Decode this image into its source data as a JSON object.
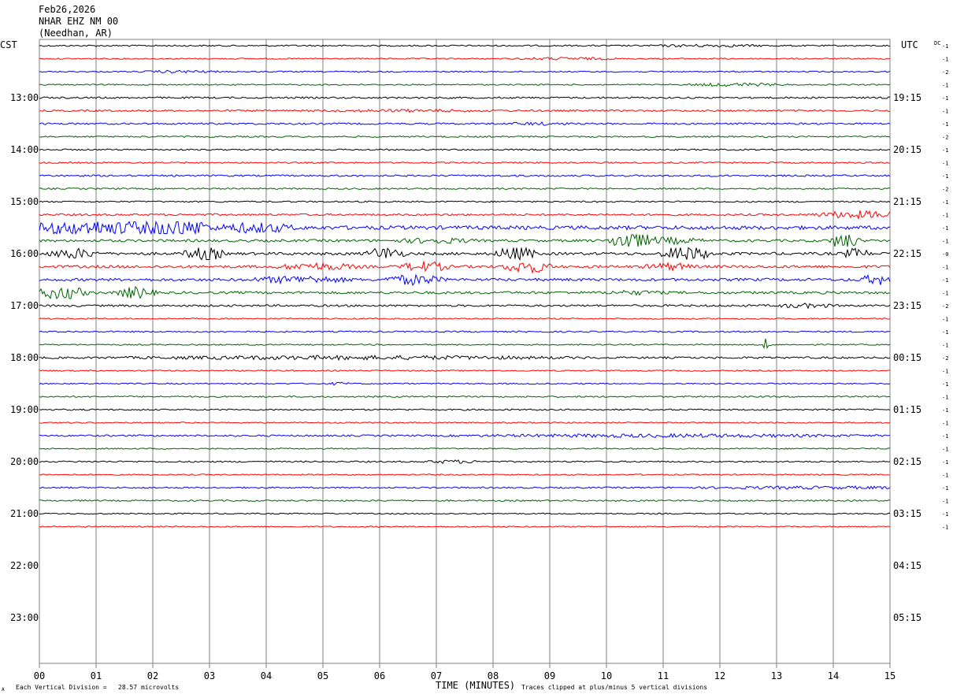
{
  "header": {
    "date": "Feb26,2026",
    "station": "NHAR EHZ NM 00",
    "location": "(Needhan, AR)"
  },
  "left_tz": "CST",
  "right_tz": "UTC",
  "dc_label": "DC",
  "footer": {
    "scale_note": "Each Vertical Division =   28.57 microvolts",
    "xlabel": "TIME (MINUTES)",
    "clip_note": "Traces clipped at plus/minus 5 vertical divisions",
    "mark": "A"
  },
  "colors": {
    "trace_cycle": [
      "#000000",
      "#ff0000",
      "#0000ff",
      "#006400"
    ],
    "grid": "#808080"
  },
  "chart_data": {
    "type": "line",
    "title": "",
    "xlabel": "TIME (MINUTES)",
    "ylabel": "",
    "xlim": [
      0,
      15
    ],
    "x_ticks": [
      "00",
      "01",
      "02",
      "03",
      "04",
      "05",
      "06",
      "07",
      "08",
      "09",
      "10",
      "11",
      "12",
      "13",
      "14",
      "15"
    ],
    "traces_per_hour": 4,
    "rows_total": 44,
    "left_hour_labels": [
      "13:00",
      "14:00",
      "15:00",
      "16:00",
      "17:00",
      "18:00",
      "19:00",
      "20:00",
      "21:00",
      "22:00",
      "23:00"
    ],
    "right_hour_labels": [
      "19:15",
      "20:15",
      "21:15",
      "22:15",
      "23:15",
      "00:15",
      "01:15",
      "02:15",
      "03:15",
      "04:15",
      "05:15"
    ],
    "dc_offsets": [
      "-1",
      "-1",
      "-2",
      "-1",
      "-1",
      "-1",
      "-1",
      "-2",
      "-1",
      "-1",
      "-1",
      "-2",
      "-1",
      "-1",
      "-1",
      "-1",
      "-0",
      "-1",
      "-1",
      "-1",
      "-2",
      "-1",
      "-1",
      "-1",
      "-2",
      "-1",
      "-1",
      "-1",
      "-1",
      "-1",
      "-1",
      "-1",
      "-1",
      "-1",
      "-1",
      "-1",
      "-1",
      "-1"
    ],
    "traces": [
      {
        "color": "#000000",
        "amp": 0.6,
        "events": [
          [
            11.8,
            1.2,
            2
          ]
        ]
      },
      {
        "color": "#ff0000",
        "amp": 0.5,
        "events": [
          [
            9.3,
            1.0,
            2.5
          ]
        ]
      },
      {
        "color": "#0000ff",
        "amp": 0.5,
        "events": [
          [
            2.5,
            0.8,
            2.5
          ]
        ]
      },
      {
        "color": "#006400",
        "amp": 0.5,
        "events": [
          [
            12.3,
            1.0,
            3
          ]
        ]
      },
      {
        "color": "#000000",
        "amp": 0.7,
        "events": []
      },
      {
        "color": "#ff0000",
        "amp": 0.7,
        "events": [
          [
            6.5,
            2.0,
            1.8
          ]
        ]
      },
      {
        "color": "#0000ff",
        "amp": 0.7,
        "events": [
          [
            8.8,
            0.6,
            2
          ]
        ]
      },
      {
        "color": "#006400",
        "amp": 0.6,
        "events": []
      },
      {
        "color": "#000000",
        "amp": 0.6,
        "events": []
      },
      {
        "color": "#ff0000",
        "amp": 0.6,
        "events": []
      },
      {
        "color": "#0000ff",
        "amp": 0.7,
        "events": []
      },
      {
        "color": "#006400",
        "amp": 0.6,
        "events": []
      },
      {
        "color": "#000000",
        "amp": 0.6,
        "events": []
      },
      {
        "color": "#ff0000",
        "amp": 0.8,
        "events": [
          [
            14.5,
            1.0,
            4
          ]
        ]
      },
      {
        "color": "#0000ff",
        "amp": 1.5,
        "events": [
          [
            1.0,
            2.0,
            4
          ],
          [
            2.5,
            0.6,
            5
          ],
          [
            3.8,
            0.8,
            3
          ]
        ]
      },
      {
        "color": "#006400",
        "amp": 1.0,
        "events": [
          [
            7.0,
            0.8,
            2.5
          ],
          [
            10.4,
            0.4,
            8
          ],
          [
            11.0,
            0.8,
            3
          ],
          [
            14.2,
            0.3,
            7
          ]
        ]
      },
      {
        "color": "#000000",
        "amp": 1.1,
        "events": [
          [
            0.6,
            0.5,
            4
          ],
          [
            2.9,
            0.4,
            6
          ],
          [
            6.1,
            0.4,
            5
          ],
          [
            8.4,
            0.4,
            6
          ],
          [
            11.4,
            0.5,
            6
          ],
          [
            14.4,
            0.3,
            4
          ]
        ]
      },
      {
        "color": "#ff0000",
        "amp": 1.1,
        "events": [
          [
            4.9,
            0.8,
            3
          ],
          [
            6.8,
            0.5,
            4
          ],
          [
            8.6,
            0.5,
            5
          ],
          [
            11.1,
            0.5,
            3
          ]
        ]
      },
      {
        "color": "#0000ff",
        "amp": 1.1,
        "events": [
          [
            4.6,
            1.0,
            3
          ],
          [
            6.6,
            0.6,
            4
          ],
          [
            14.8,
            0.4,
            4
          ]
        ]
      },
      {
        "color": "#006400",
        "amp": 1.0,
        "events": [
          [
            0.4,
            0.5,
            6
          ],
          [
            1.7,
            0.4,
            5
          ],
          [
            10.5,
            0.6,
            2
          ]
        ]
      },
      {
        "color": "#000000",
        "amp": 0.8,
        "events": [
          [
            13.5,
            0.6,
            2.5
          ]
        ]
      },
      {
        "color": "#ff0000",
        "amp": 0.5,
        "events": []
      },
      {
        "color": "#0000ff",
        "amp": 0.6,
        "events": []
      },
      {
        "color": "#006400",
        "amp": 0.5,
        "events": [
          [
            12.8,
            0.1,
            10
          ]
        ]
      },
      {
        "color": "#000000",
        "amp": 0.8,
        "events": [
          [
            5.5,
            4.5,
            2.2
          ]
        ]
      },
      {
        "color": "#ff0000",
        "amp": 0.5,
        "events": []
      },
      {
        "color": "#0000ff",
        "amp": 0.5,
        "events": [
          [
            5.3,
            0.2,
            3
          ]
        ]
      },
      {
        "color": "#006400",
        "amp": 0.6,
        "events": []
      },
      {
        "color": "#000000",
        "amp": 0.6,
        "events": []
      },
      {
        "color": "#ff0000",
        "amp": 0.5,
        "events": []
      },
      {
        "color": "#0000ff",
        "amp": 0.7,
        "events": [
          [
            11.0,
            4.0,
            2.2
          ]
        ]
      },
      {
        "color": "#006400",
        "amp": 0.5,
        "events": []
      },
      {
        "color": "#000000",
        "amp": 0.6,
        "events": [
          [
            7.3,
            0.6,
            2.5
          ]
        ]
      },
      {
        "color": "#ff0000",
        "amp": 0.5,
        "events": []
      },
      {
        "color": "#0000ff",
        "amp": 0.6,
        "events": [
          [
            13.7,
            2.5,
            2.2
          ]
        ]
      },
      {
        "color": "#006400",
        "amp": 0.6,
        "events": []
      },
      {
        "color": "#000000",
        "amp": 0.5,
        "events": []
      },
      {
        "color": "#ff0000",
        "amp": 0.5,
        "events": []
      }
    ]
  }
}
